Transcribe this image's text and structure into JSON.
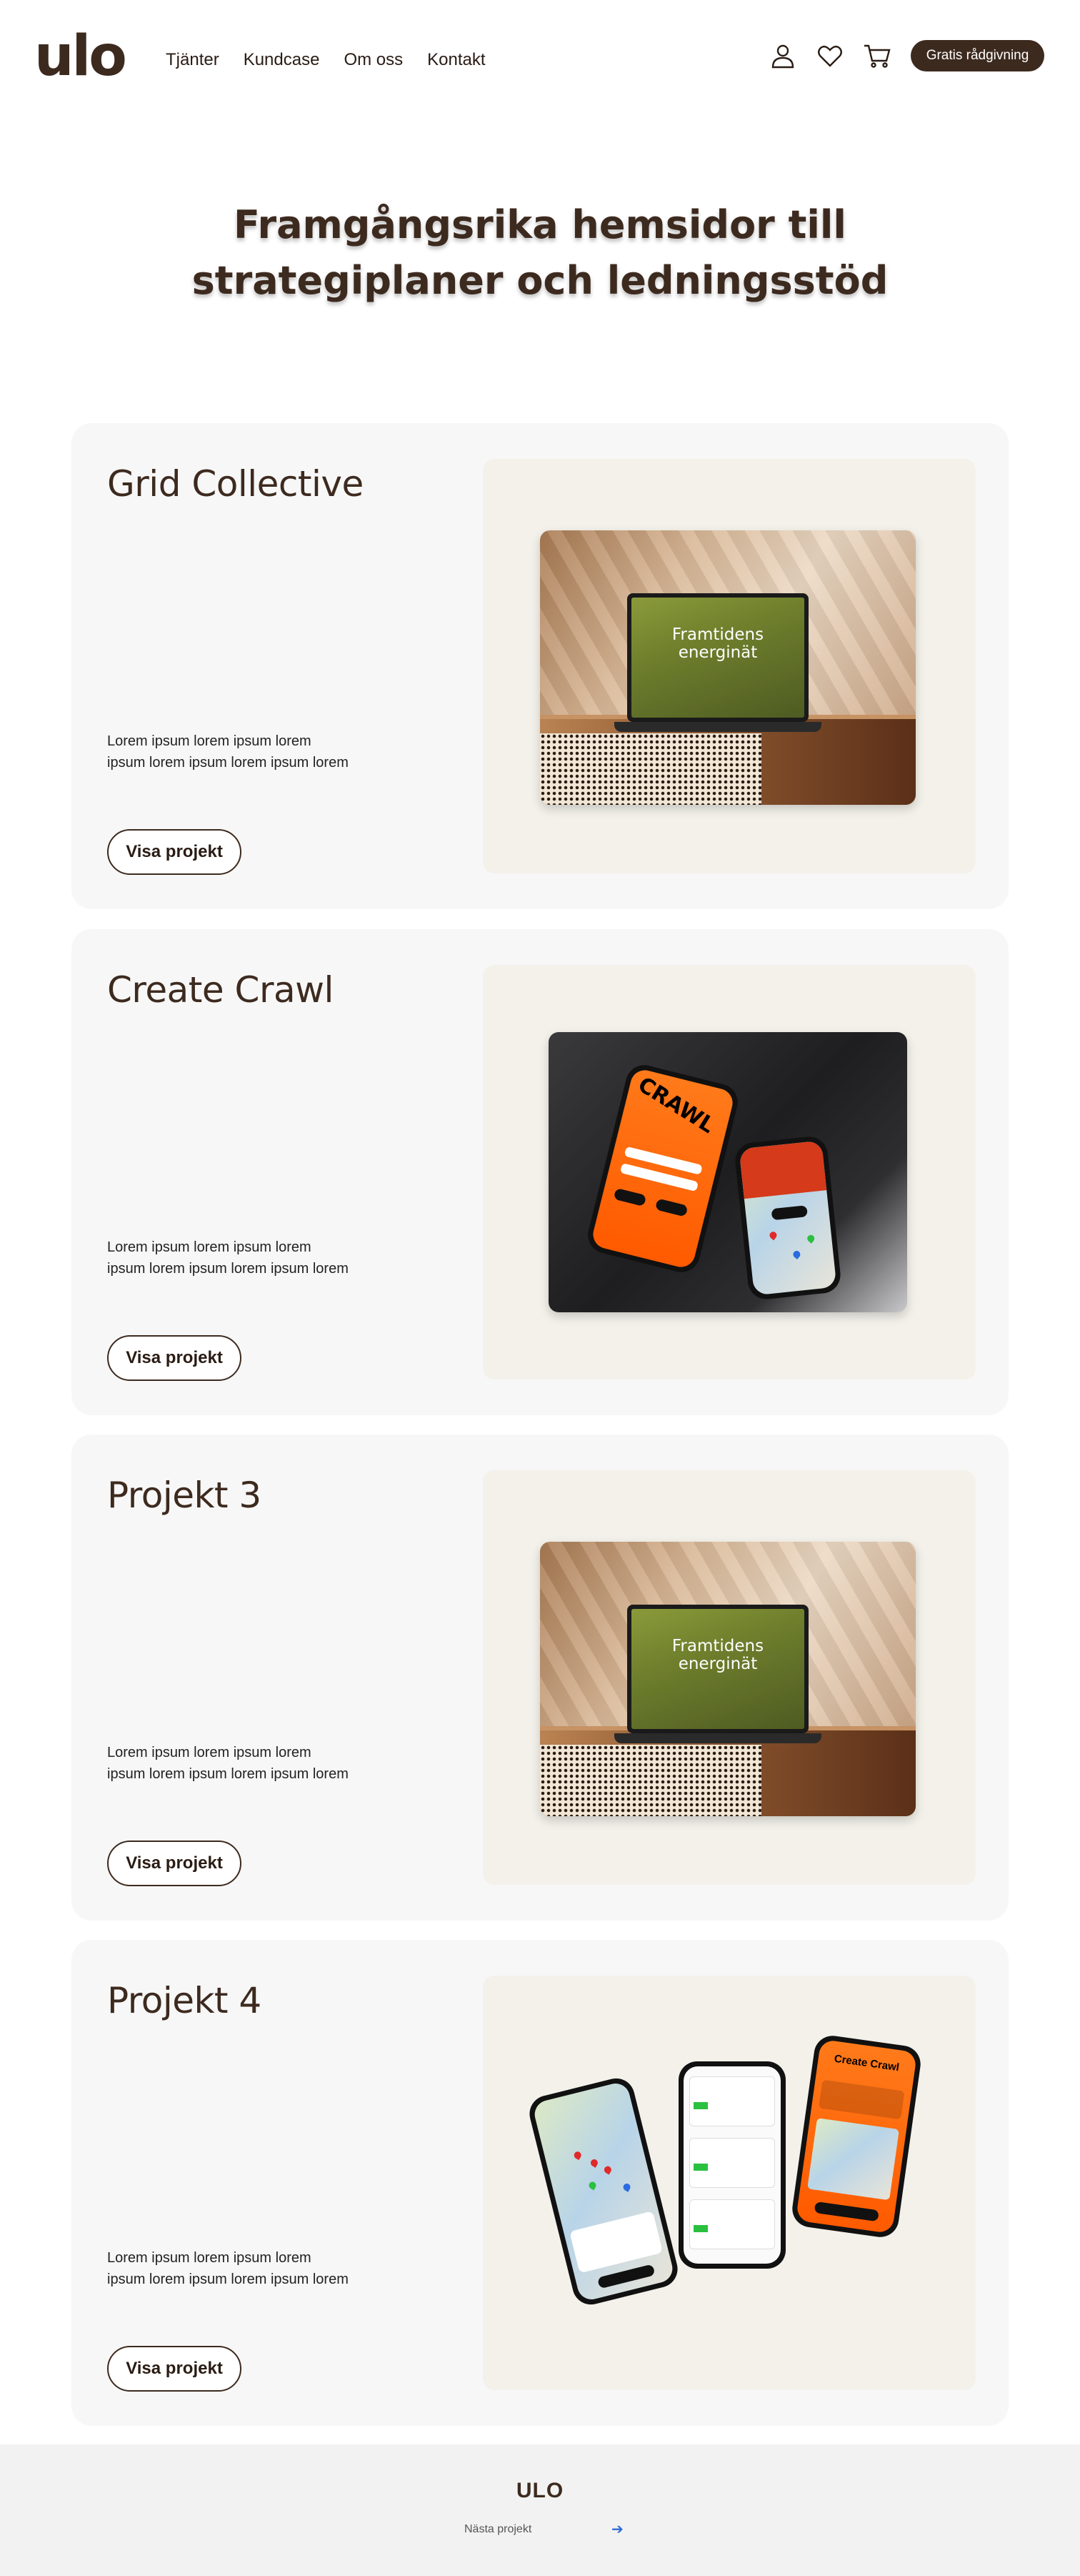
{
  "header": {
    "logo": "ulo",
    "nav": [
      "Tjänter",
      "Kundcase",
      "Om oss",
      "Kontakt"
    ],
    "icons": [
      "user-icon",
      "heart-icon",
      "cart-icon"
    ],
    "cta": "Gratis rådgivning"
  },
  "hero": {
    "title": "Framgångsrika hemsidor till strategiplaner och ledningsstöd"
  },
  "cards": [
    {
      "title": "Grid Collective",
      "desc": "Lorem ipsum lorem ipsum lorem ipsum  lorem ipsum lorem ipsum lorem",
      "button": "Visa projekt",
      "screen_text": "Framtidens energinät"
    },
    {
      "title": "Create Crawl",
      "desc": "Lorem ipsum lorem ipsum lorem ipsum  lorem ipsum lorem ipsum lorem",
      "button": "Visa projekt",
      "screen_text": "CRAWL"
    },
    {
      "title": "Projekt 3",
      "desc": "Lorem ipsum lorem ipsum lorem ipsum  lorem ipsum lorem ipsum lorem",
      "button": "Visa projekt",
      "screen_text": "Framtidens energinät"
    },
    {
      "title": "Projekt 4",
      "desc": "Lorem ipsum lorem ipsum lorem ipsum  lorem ipsum lorem ipsum lorem",
      "button": "Visa projekt",
      "screen_text": "Create Crawl"
    }
  ],
  "footer": {
    "logo": "ULO",
    "next": "Nästa projekt"
  },
  "colors": {
    "brand": "#3d2a1f",
    "card_bg": "#f7f7f7",
    "media_bg": "#f3f1ea",
    "accent_orange": "#ff6a00",
    "link_blue": "#2f6bd8"
  }
}
